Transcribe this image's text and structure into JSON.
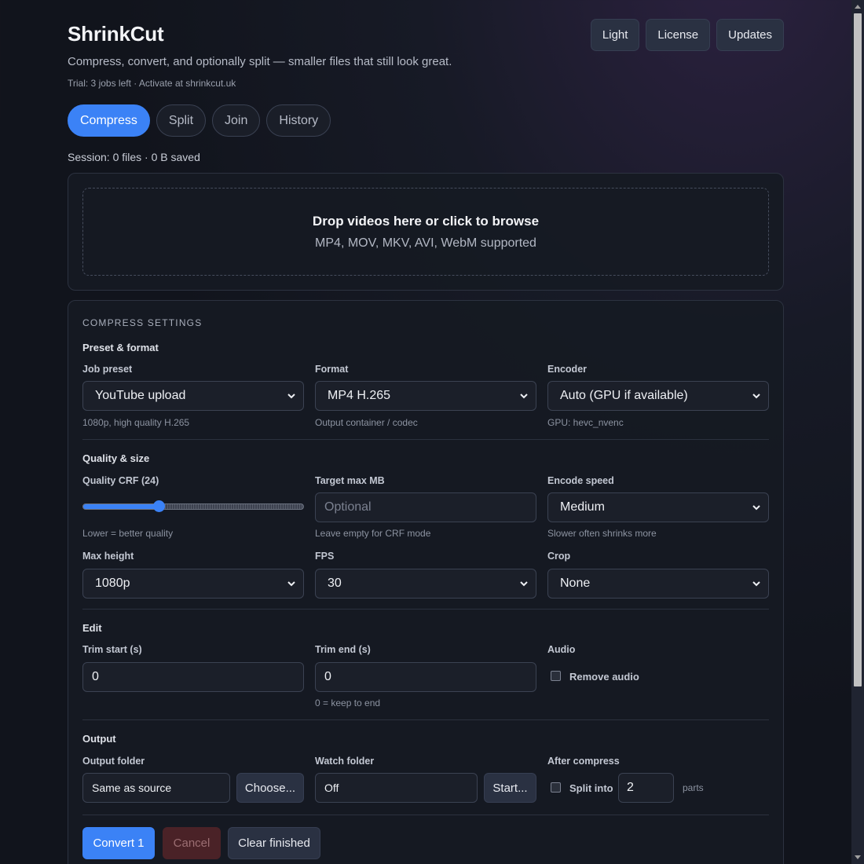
{
  "app": {
    "title": "ShrinkCut",
    "tagline": "Compress, convert, and optionally split — smaller files that still look great.",
    "trial": "Trial: 3 jobs left · Activate at shrinkcut.uk"
  },
  "top_actions": {
    "light": "Light",
    "license": "License",
    "updates": "Updates"
  },
  "tabs": [
    {
      "label": "Compress",
      "active": true
    },
    {
      "label": "Split",
      "active": false
    },
    {
      "label": "Join",
      "active": false
    },
    {
      "label": "History",
      "active": false
    }
  ],
  "session": "Session: 0 files · 0 B saved",
  "dropzone": {
    "title": "Drop videos here or click to browse",
    "subtitle": "MP4, MOV, MKV, AVI, WebM supported"
  },
  "settings": {
    "caption": "COMPRESS SETTINGS",
    "preset_format": {
      "title": "Preset & format",
      "job_preset": {
        "label": "Job preset",
        "value": "YouTube upload",
        "hint": "1080p, high quality H.265"
      },
      "format": {
        "label": "Format",
        "value": "MP4 H.265",
        "hint": "Output container / codec"
      },
      "encoder": {
        "label": "Encoder",
        "value": "Auto (GPU if available)",
        "hint": "GPU: hevc_nvenc"
      }
    },
    "quality_size": {
      "title": "Quality & size",
      "crf": {
        "label": "Quality CRF (24)",
        "value": 24,
        "min": 0,
        "max": 70,
        "hint": "Lower = better quality"
      },
      "target_mb": {
        "label": "Target max MB",
        "placeholder": "Optional",
        "hint": "Leave empty for CRF mode"
      },
      "speed": {
        "label": "Encode speed",
        "value": "Medium",
        "hint": "Slower often shrinks more"
      },
      "max_height": {
        "label": "Max height",
        "value": "1080p"
      },
      "fps": {
        "label": "FPS",
        "value": "30"
      },
      "crop": {
        "label": "Crop",
        "value": "None"
      }
    },
    "edit": {
      "title": "Edit",
      "trim_start": {
        "label": "Trim start (s)",
        "value": "0"
      },
      "trim_end": {
        "label": "Trim end (s)",
        "value": "0",
        "hint": "0 = keep to end"
      },
      "audio": {
        "label": "Audio",
        "remove_label": "Remove audio",
        "checked": false
      }
    },
    "output": {
      "title": "Output",
      "folder": {
        "label": "Output folder",
        "value": "Same as source",
        "button": "Choose..."
      },
      "watch": {
        "label": "Watch folder",
        "value": "Off",
        "button": "Start..."
      },
      "after": {
        "label": "After compress",
        "split_label": "Split into",
        "parts_value": "2",
        "parts_suffix": "parts",
        "checked": false
      }
    },
    "actions": {
      "convert": "Convert 1",
      "cancel": "Cancel",
      "clear": "Clear finished"
    }
  },
  "colors": {
    "accent": "#3b82f6",
    "background": "#11141c",
    "card": "#161a23",
    "danger": "#4a2227"
  }
}
